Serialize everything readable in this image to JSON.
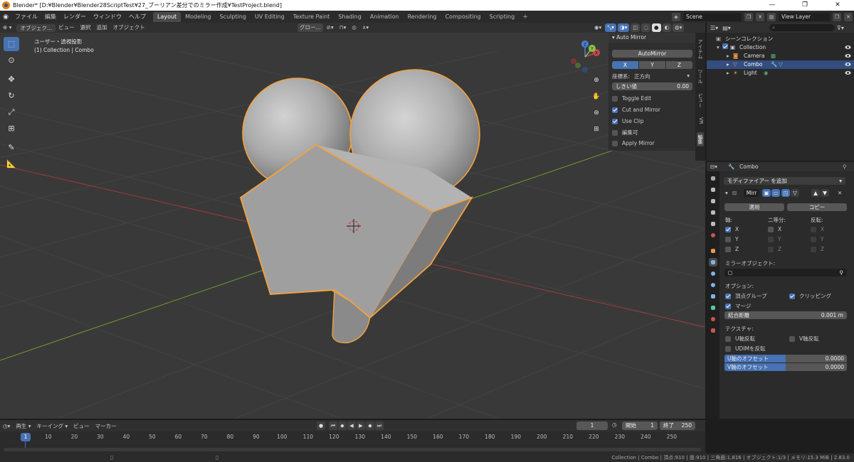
{
  "window": {
    "title": "Blender* [D:¥Blender¥Blender28ScriptTest¥27_ブーリアン差分でのミラー作成¥TestProject.blend]",
    "minimize": "—",
    "maximize": "❐",
    "close": "✕"
  },
  "menu": [
    "ファイル",
    "編集",
    "レンダー",
    "ウィンドウ",
    "ヘルプ"
  ],
  "workspaces": [
    "Layout",
    "Modeling",
    "Sculpting",
    "UV Editing",
    "Texture Paint",
    "Shading",
    "Animation",
    "Rendering",
    "Compositing",
    "Scripting"
  ],
  "active_workspace": "Layout",
  "scene": {
    "name": "Scene",
    "view_layer": "View Layer"
  },
  "viewport": {
    "mode": "オブジェク...",
    "menus": [
      "ビュー",
      "選択",
      "追加",
      "オブジェクト"
    ],
    "orientation": "グロー...",
    "view_label": "ユーザー・透視投影",
    "collection_label": "(1) Collection | Combo"
  },
  "auto_mirror": {
    "title": "Auto Mirror",
    "button": "AutoMirror",
    "axes": [
      "X",
      "Y",
      "Z"
    ],
    "active_axis": "X",
    "orientation_label": "座標系:",
    "orientation_value": "正方向",
    "threshold_label": "しきい値",
    "threshold_value": "0.00",
    "options": [
      {
        "label": "Toggle Edit",
        "checked": false
      },
      {
        "label": "Cut and Mirror",
        "checked": true
      },
      {
        "label": "Use Clip",
        "checked": true
      },
      {
        "label": "編集可",
        "checked": false
      },
      {
        "label": "Apply Mirror",
        "checked": false
      }
    ]
  },
  "side_tabs": [
    "アイテム",
    "ツール",
    "ビュー",
    "VR",
    "編集"
  ],
  "outliner": {
    "root": "シーンコレクション",
    "collection": "Collection",
    "items": [
      "Camera",
      "Combo",
      "Light"
    ],
    "selected": "Combo"
  },
  "properties": {
    "object_name": "Combo",
    "add_modifier": "モディファイアー を追加",
    "modifier_name": "Mirr",
    "apply": "適用",
    "copy": "コピー",
    "axis_label": "軸:",
    "bisect_label": "二等分:",
    "flip_label": "反転:",
    "axes": [
      "X",
      "Y",
      "Z"
    ],
    "axis_checked": [
      true,
      false,
      false
    ],
    "mirror_object_label": "ミラーオブジェクト:",
    "options_label": "オプション:",
    "vertex_groups": "頂点グループ",
    "clipping": "クリッピング",
    "merge": "マージ",
    "merge_distance_label": "結合距離",
    "merge_distance_value": "0.001 m",
    "textures_label": "テクスチャ:",
    "flip_u": "U軸反転",
    "flip_v": "V軸反転",
    "flip_udim": "UDIMを反転",
    "u_offset_label": "U軸のオフセット",
    "u_offset_value": "0.0000",
    "v_offset_label": "V軸のオフセット",
    "v_offset_value": "0.0000"
  },
  "timeline": {
    "menus": [
      "再生",
      "キーイング",
      "ビュー",
      "マーカー"
    ],
    "current_frame": "1",
    "start_label": "開始",
    "start_value": "1",
    "end_label": "終了",
    "end_value": "250",
    "ticks": [
      "10",
      "20",
      "30",
      "40",
      "50",
      "60",
      "70",
      "80",
      "90",
      "100",
      "110",
      "120",
      "130",
      "140",
      "150",
      "160",
      "170",
      "180",
      "190",
      "200",
      "210",
      "220",
      "230",
      "240",
      "250"
    ],
    "cursor_frame": "1"
  },
  "status": "Collection | Combo | 頂点:910 | 面:910 | 三角面:1,816 | オブジェクト:1/3 | メモリ:15.3 MiB | 2.83.0",
  "colors": {
    "accent": "#4772b3",
    "selection_outline": "#f4a13d",
    "x_axis": "#a2393b",
    "y_axis": "#6d9b2e"
  }
}
